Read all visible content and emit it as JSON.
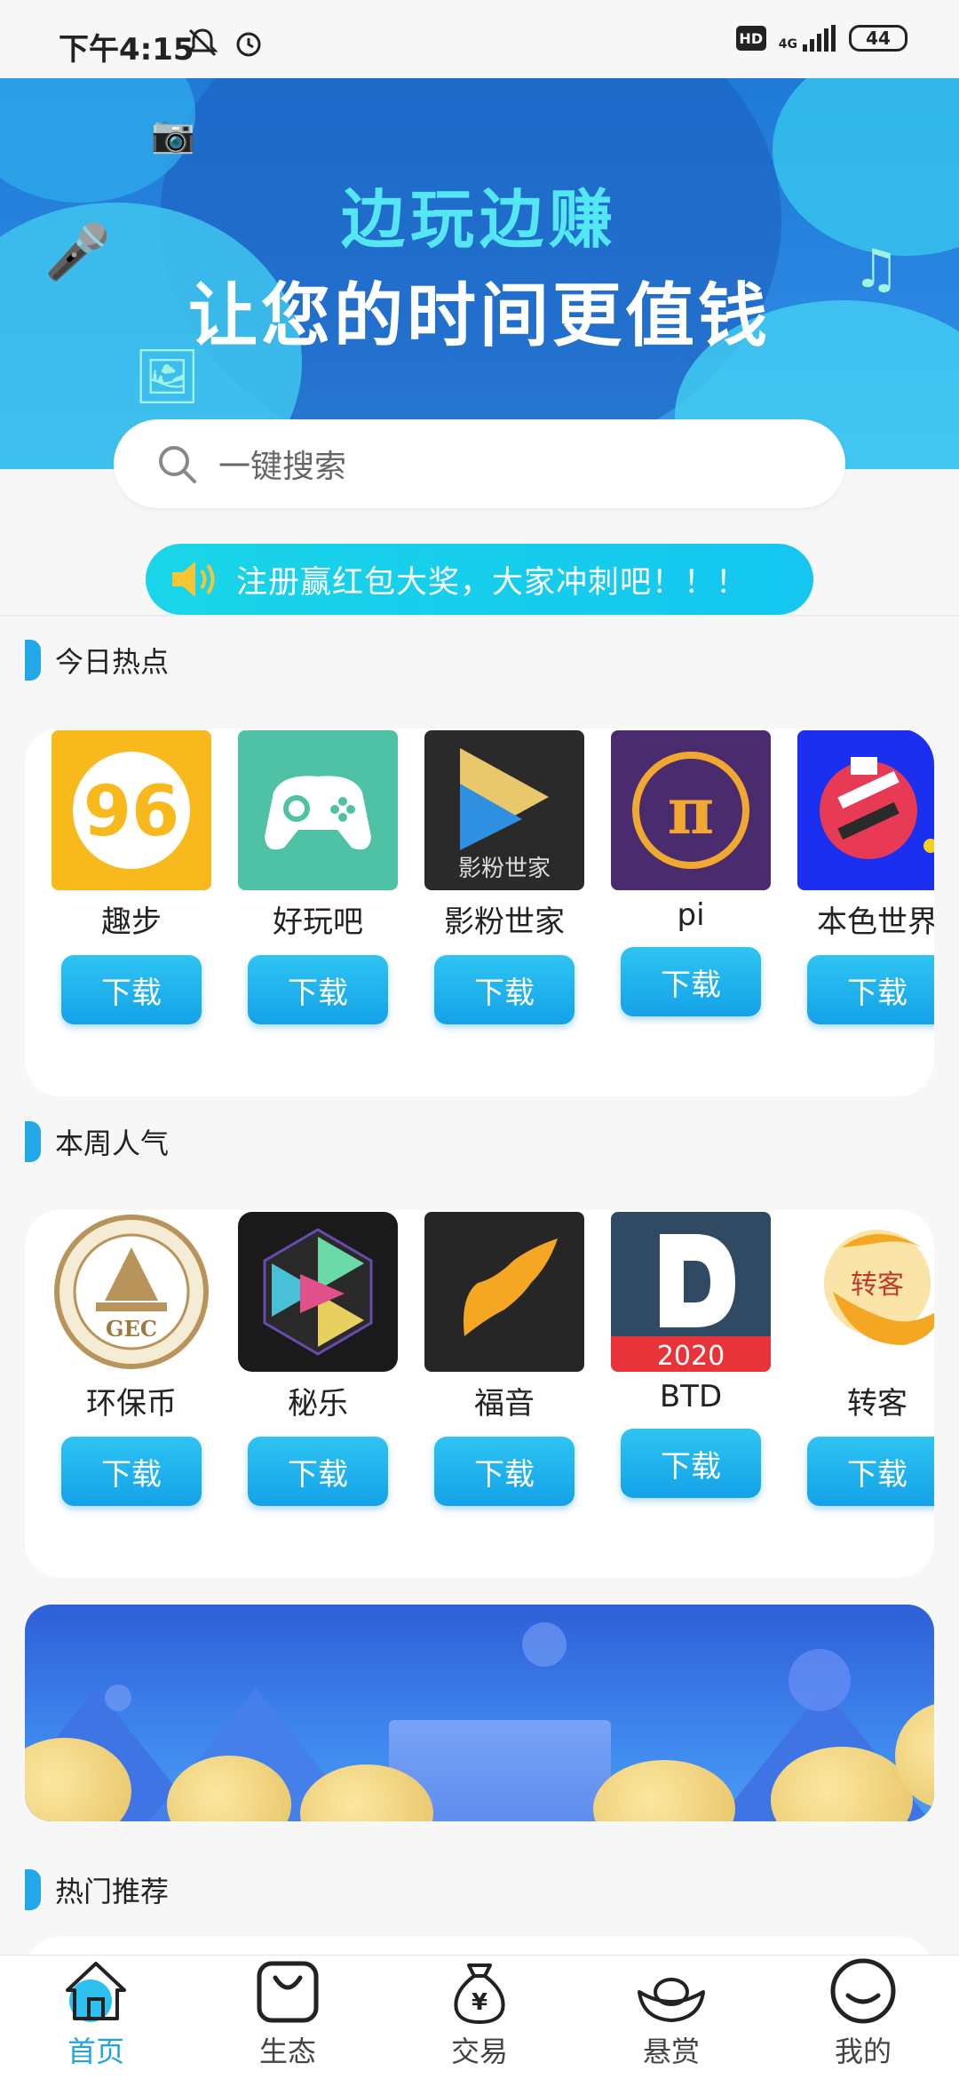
{
  "status_bar": {
    "time": "下午4:15",
    "hd": "HD",
    "network": "4G",
    "battery": "44"
  },
  "banner": {
    "title_line1": "边玩边赚",
    "title_line2": "让您的时间更值钱"
  },
  "search": {
    "placeholder": "一键搜索"
  },
  "notice": {
    "text": "注册赢红包大奖，大家冲刺吧！！！"
  },
  "sections": {
    "today_hot": {
      "title": "今日热点",
      "apps": [
        {
          "name": "趣步",
          "icon": "qubu-icon",
          "button": "下载"
        },
        {
          "name": "好玩吧",
          "icon": "gamepad-icon",
          "button": "下载"
        },
        {
          "name": "影粉世家",
          "icon": "play-icon",
          "icon_text": "影粉世家",
          "button": "下载"
        },
        {
          "name": "pi",
          "icon": "pi-icon",
          "button": "下载"
        },
        {
          "name": "本色世界",
          "icon": "bense-icon",
          "button": "下载"
        }
      ]
    },
    "week_popular": {
      "title": "本周人气",
      "apps": [
        {
          "name": "环保币",
          "icon": "gec-icon",
          "icon_text": "GEC",
          "button": "下载"
        },
        {
          "name": "秘乐",
          "icon": "mile-icon",
          "button": "下载"
        },
        {
          "name": "福音",
          "icon": "wing-icon",
          "button": "下载"
        },
        {
          "name": "BTD",
          "icon": "btd-icon",
          "icon_text": "2020",
          "button": "下载"
        },
        {
          "name": "转客",
          "icon": "zhuanke-icon",
          "icon_text": "转客",
          "button": "下载"
        }
      ]
    },
    "hot_recommend": {
      "title": "热门推荐"
    }
  },
  "tabbar": {
    "items": [
      {
        "label": "首页",
        "icon": "home-icon",
        "active": true
      },
      {
        "label": "生态",
        "icon": "bag-icon",
        "active": false
      },
      {
        "label": "交易",
        "icon": "money-bag-icon",
        "active": false
      },
      {
        "label": "悬赏",
        "icon": "ingot-icon",
        "active": false
      },
      {
        "label": "我的",
        "icon": "smile-icon",
        "active": false
      }
    ]
  },
  "colors": {
    "accent": "#1ea3e6",
    "notice_bg": "#14c6f0",
    "button_top": "#2ec4f2",
    "button_bottom": "#14a2e8"
  }
}
